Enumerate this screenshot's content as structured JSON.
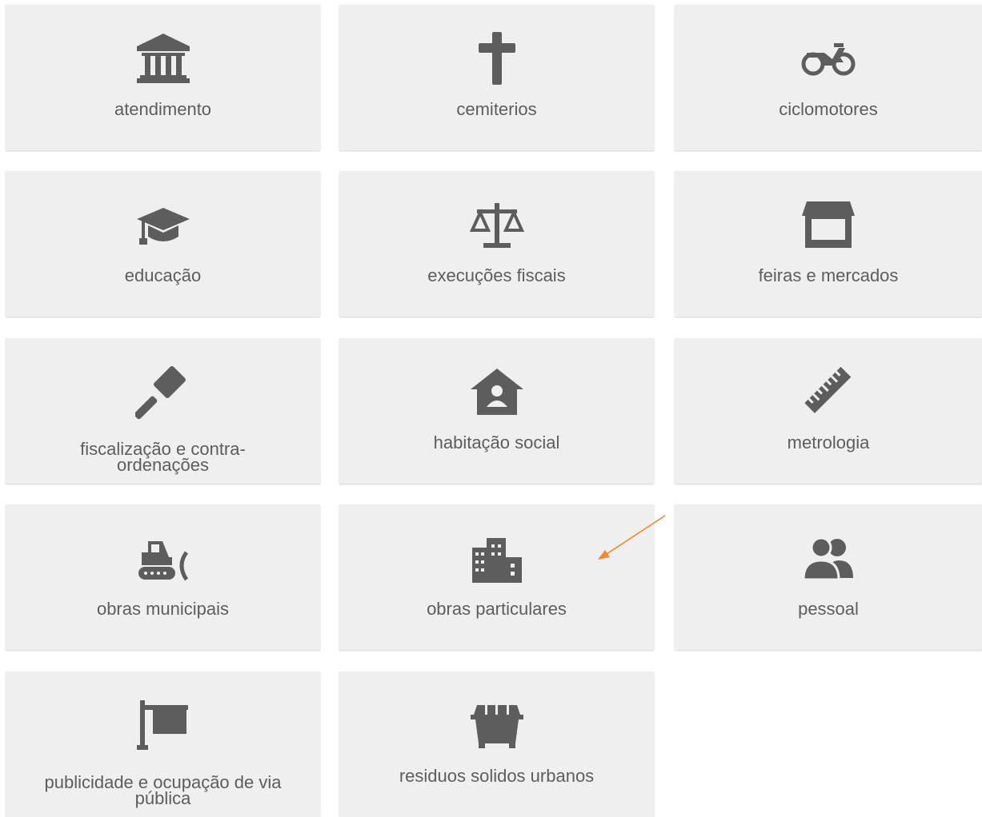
{
  "colors": {
    "tile_bg": "#efefef",
    "icon": "#5d5d5d",
    "text": "#5d5d5d",
    "arrow": "#f08a33"
  },
  "tiles": [
    {
      "label": "atendimento",
      "icon": "bank-icon"
    },
    {
      "label": "cemiterios",
      "icon": "cross-icon"
    },
    {
      "label": "ciclomotores",
      "icon": "motorcycle-icon"
    },
    {
      "label": "educação",
      "icon": "graduation-cap-icon"
    },
    {
      "label": "execuções fiscais",
      "icon": "scale-icon"
    },
    {
      "label": "feiras e mercados",
      "icon": "store-icon"
    },
    {
      "label": "fiscalização e contra-ordenações",
      "label_line1": "fiscalização e contra-",
      "label_line2": "ordenações",
      "icon": "gavel-icon"
    },
    {
      "label": "habitação social",
      "icon": "house-user-icon"
    },
    {
      "label": "metrologia",
      "icon": "ruler-icon"
    },
    {
      "label": "obras municipais",
      "icon": "bulldozer-icon"
    },
    {
      "label": "obras particulares",
      "icon": "city-buildings-icon"
    },
    {
      "label": "pessoal",
      "icon": "users-icon"
    },
    {
      "label": "publicidade e ocupação de via pública",
      "label_line1": "publicidade e ocupação de via",
      "label_line2": "pública",
      "icon": "sign-icon"
    },
    {
      "label": "residuos solidos urbanos",
      "icon": "dumpster-icon"
    }
  ]
}
